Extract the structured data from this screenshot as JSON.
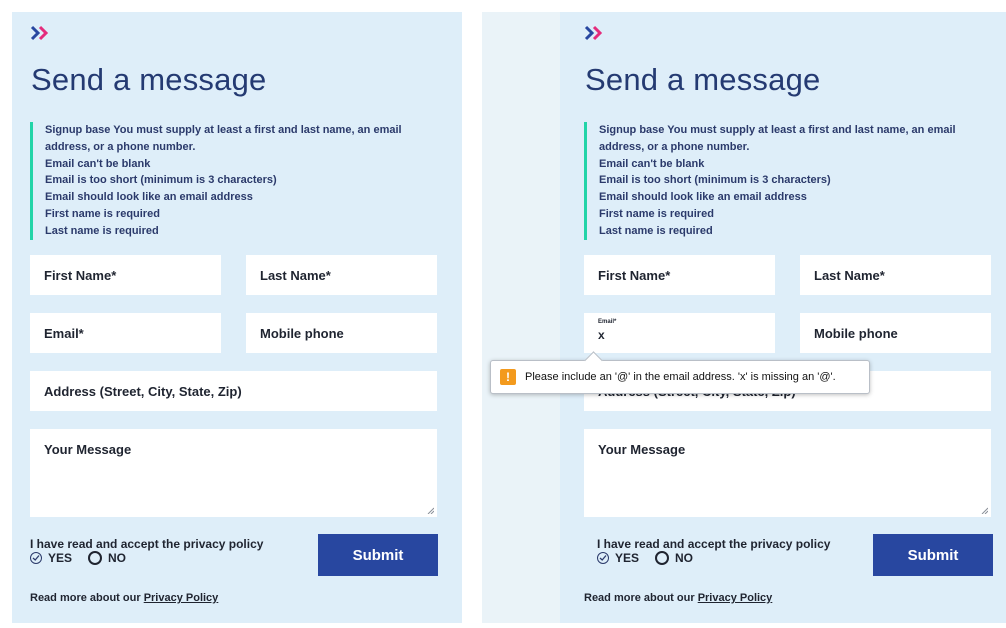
{
  "colors": {
    "accent_green": "#22d4a8",
    "title_blue": "#243a72",
    "submit_blue": "#2847a0",
    "chevron_blue": "#2847a0",
    "chevron_pink": "#e42c7c",
    "warning_orange": "#f39a1d"
  },
  "form": {
    "title": "Send a message",
    "errors": [
      "Signup base You must supply at least a first and last name, an email",
      "address, or a phone number.",
      "Email can't be blank",
      "Email is too short (minimum is 3 characters)",
      "Email should look like an email address",
      "First name is required",
      "Last name is required"
    ],
    "first_name_label": "First Name*",
    "last_name_label": "Last Name*",
    "email_label": "Email*",
    "mobile_label": "Mobile phone",
    "address_label": "Address (Street, City, State, Zip)",
    "message_label": "Your Message",
    "privacy_question": "I have read and accept the privacy policy",
    "yes_label": "YES",
    "no_label": "NO",
    "submit_label": "Submit",
    "read_more": "Read more about our",
    "privacy_link": "Privacy Policy"
  },
  "right_form": {
    "email_mini_label": "Email*",
    "email_value": "x"
  },
  "tooltip": {
    "icon": "warning-icon",
    "message": "Please include an '@' in the email address. 'x' is missing an '@'."
  }
}
